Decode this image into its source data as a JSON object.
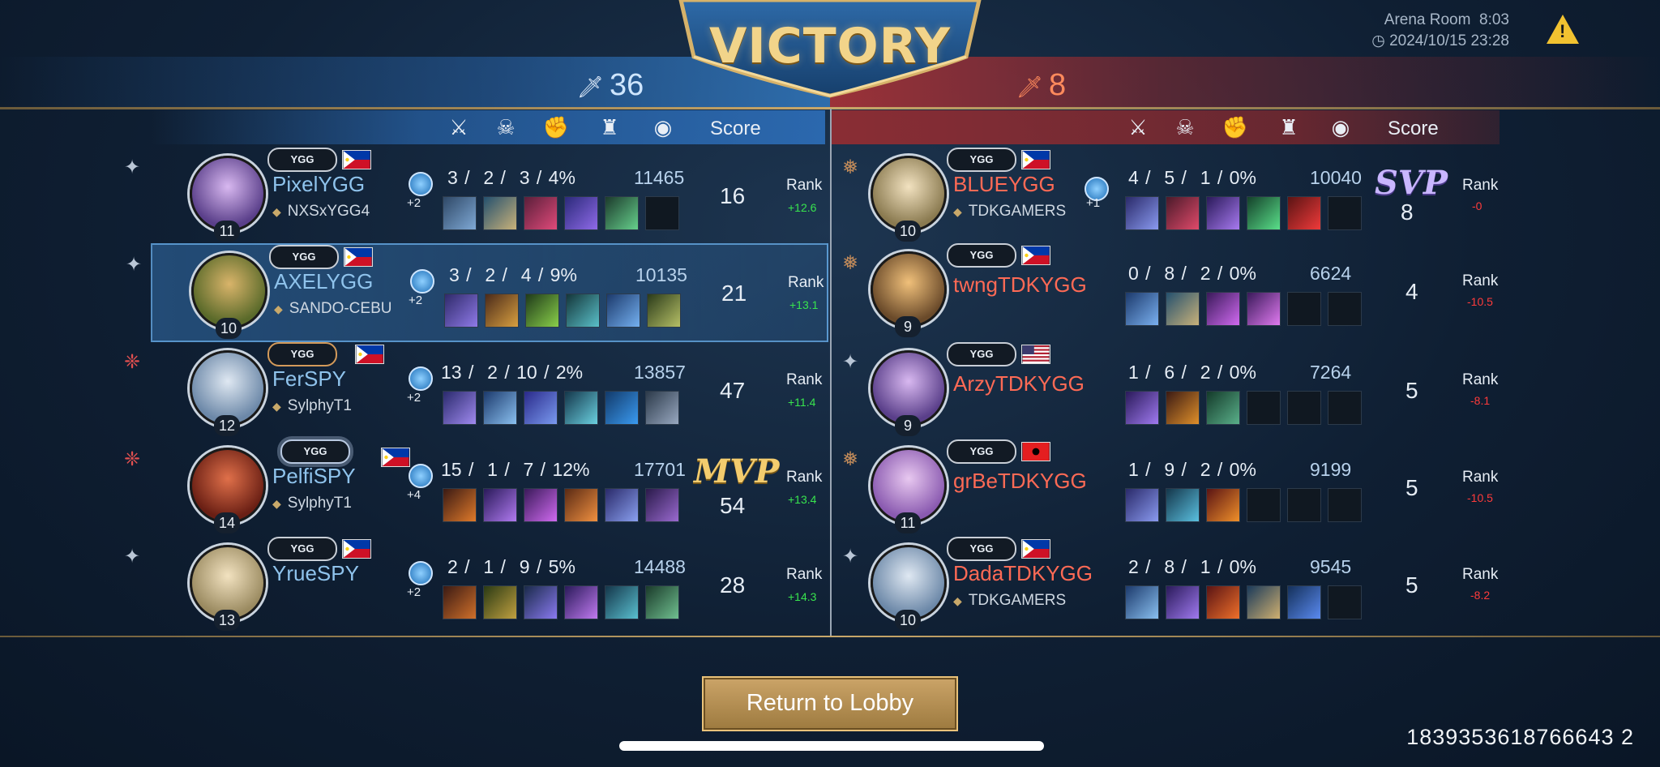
{
  "header": {
    "result": "VICTORY",
    "blue_kills": "36",
    "red_kills": "8",
    "room_label": "Arena Room",
    "duration": "8:03",
    "datetime": "2024/10/15 23:28",
    "warning_icon": "!"
  },
  "columns": {
    "icons": [
      "kills-icon",
      "kda-icon",
      "damage-icon",
      "tower-icon",
      "gold-icon"
    ],
    "score": "Score"
  },
  "colors": {
    "blue_name": "#8fc3ec",
    "red_name": "#ff6a55",
    "rank_up": "#38e44e",
    "rank_down": "#ff3b3b",
    "mvp": "#f3cc6e",
    "svp": "#c9b6ff"
  },
  "blue": [
    {
      "name": "PixelYGG",
      "guild": "NXSxYGG4",
      "clan": "YGG",
      "level": "11",
      "spell_plus": "+2",
      "kda": "3 /  2 /  3 /",
      "kp": "4%",
      "gold": "11465",
      "score": "16",
      "rank_label": "Rank",
      "rank_change": "+12.6",
      "mvp": ""
    },
    {
      "name": "AXELYGG",
      "guild": "SANDO-CEBU",
      "clan": "YGG",
      "level": "10",
      "spell_plus": "+2",
      "kda": "3 /  2 /  4 /",
      "kp": "9%",
      "gold": "10135",
      "score": "21",
      "rank_label": "Rank",
      "rank_change": "+13.1",
      "mvp": ""
    },
    {
      "name": "FerSPY",
      "guild": "SylphyT1",
      "clan": "YGG",
      "level": "12",
      "spell_plus": "+2",
      "kda": "13 /  2 / 10 /",
      "kp": "2%",
      "gold": "13857",
      "score": "47",
      "rank_label": "Rank",
      "rank_change": "+11.4",
      "mvp": ""
    },
    {
      "name": "PelfiSPY",
      "guild": "SylphyT1",
      "clan": "YGG",
      "level": "14",
      "spell_plus": "+4",
      "kda": "15 /  1 /  7 /",
      "kp": "12%",
      "gold": "17701",
      "score": "54",
      "rank_label": "Rank",
      "rank_change": "+13.4",
      "mvp": "MVP"
    },
    {
      "name": "YrueSPY",
      "guild": "",
      "clan": "YGG",
      "level": "13",
      "spell_plus": "+2",
      "kda": "2 /  1 /  9 /",
      "kp": "5%",
      "gold": "14488",
      "score": "28",
      "rank_label": "Rank",
      "rank_change": "+14.3",
      "mvp": ""
    }
  ],
  "red": [
    {
      "name": "BLUEYGG",
      "guild": "TDKGAMERS",
      "clan": "YGG",
      "level": "10",
      "spell_plus": "+1",
      "kda": "4 /  5 /  1 /",
      "kp": "0%",
      "gold": "10040",
      "score": "8",
      "rank_label": "Rank",
      "rank_change": "-0",
      "svp": "SVP"
    },
    {
      "name": "twngTDKYGG",
      "guild": "",
      "clan": "YGG",
      "level": "9",
      "spell_plus": "",
      "kda": "0 /  8 /  2 /",
      "kp": "0%",
      "gold": "6624",
      "score": "4",
      "rank_label": "Rank",
      "rank_change": "-10.5",
      "svp": ""
    },
    {
      "name": "ArzyTDKYGG",
      "guild": "",
      "clan": "YGG",
      "level": "9",
      "spell_plus": "",
      "kda": "1 /  6 /  2 /",
      "kp": "0%",
      "gold": "7264",
      "score": "5",
      "rank_label": "Rank",
      "rank_change": "-8.1",
      "svp": ""
    },
    {
      "name": "grBeTDKYGG",
      "guild": "",
      "clan": "YGG",
      "level": "11",
      "spell_plus": "",
      "kda": "1 /  9 /  2 /",
      "kp": "0%",
      "gold": "9199",
      "score": "5",
      "rank_label": "Rank",
      "rank_change": "-10.5",
      "svp": ""
    },
    {
      "name": "DadaTDKYGG",
      "guild": "TDKGAMERS",
      "clan": "YGG",
      "level": "10",
      "spell_plus": "",
      "kda": "2 /  8 /  1 /",
      "kp": "0%",
      "gold": "9545",
      "score": "5",
      "rank_label": "Rank",
      "rank_change": "-8.2",
      "svp": ""
    }
  ],
  "footer": {
    "lobby_button": "Return to Lobby",
    "match_id": "1839353618766643 2"
  }
}
